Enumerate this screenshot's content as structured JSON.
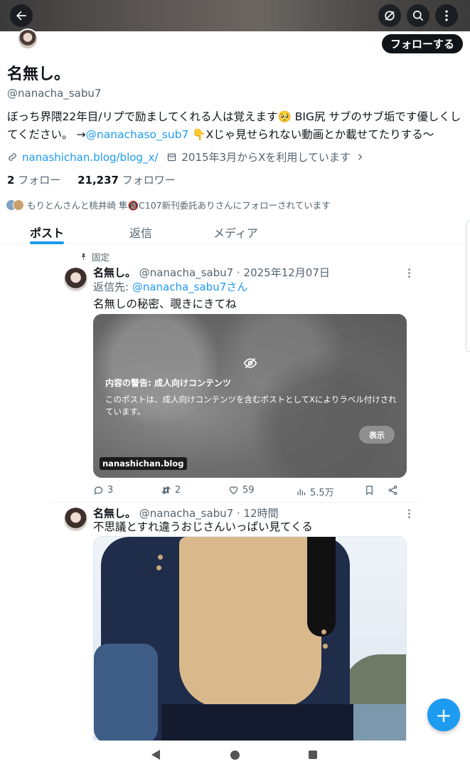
{
  "profile": {
    "name": "名無し。",
    "handle": "@nanacha_sabu7",
    "follow_button": "フォローする",
    "bio_text": "ぼっち界隈22年目/リプで励ましてくれる人は覚えます🥺 BIG尻  サブのサブ垢です優しくしてください。 →",
    "bio_link": "@nanachaso_sub7",
    "bio_tail": " 👇Xじゃ見せられない動画とか載せてたりする〜",
    "website": "nanashichan.blog/blog_x/",
    "joined": "2015年3月からXを利用しています",
    "following_count": "2",
    "following_label": "フォロー",
    "followers_count": "21,237",
    "followers_label": "フォロワー",
    "followed_by": "もりとんさんと桃井崎 隼🔞C107新刊委託ありさんにフォローされています"
  },
  "tabs": [
    "ポスト",
    "返信",
    "メディア"
  ],
  "pinned_label": "固定",
  "post1": {
    "name": "名無し。",
    "meta": "@nanacha_sabu7 · 2025年12月07日",
    "reply_prefix": "返信先: ",
    "reply_handle": "@nanacha_sabu7さん",
    "text": "名無しの秘密、覗きにきてね",
    "warning_title": "内容の警告: 成人向けコンテンツ",
    "warning_body": "このポストは、成人向けコンテンツを含むポストとしてXによりラベル付けされています。",
    "show_button": "表示",
    "domain": "nanashichan.blog",
    "replies": "3",
    "reposts": "2",
    "likes": "59",
    "views": "5.5万"
  },
  "post2": {
    "name": "名無し。",
    "meta": "@nanacha_sabu7 · 12時間",
    "text": "不思議とすれ違うおじさんいっぱい見てくる"
  },
  "fab_label": "+",
  "colors": {
    "accent": "#1d9bf0",
    "text": "#0f1419",
    "muted": "#536471"
  }
}
